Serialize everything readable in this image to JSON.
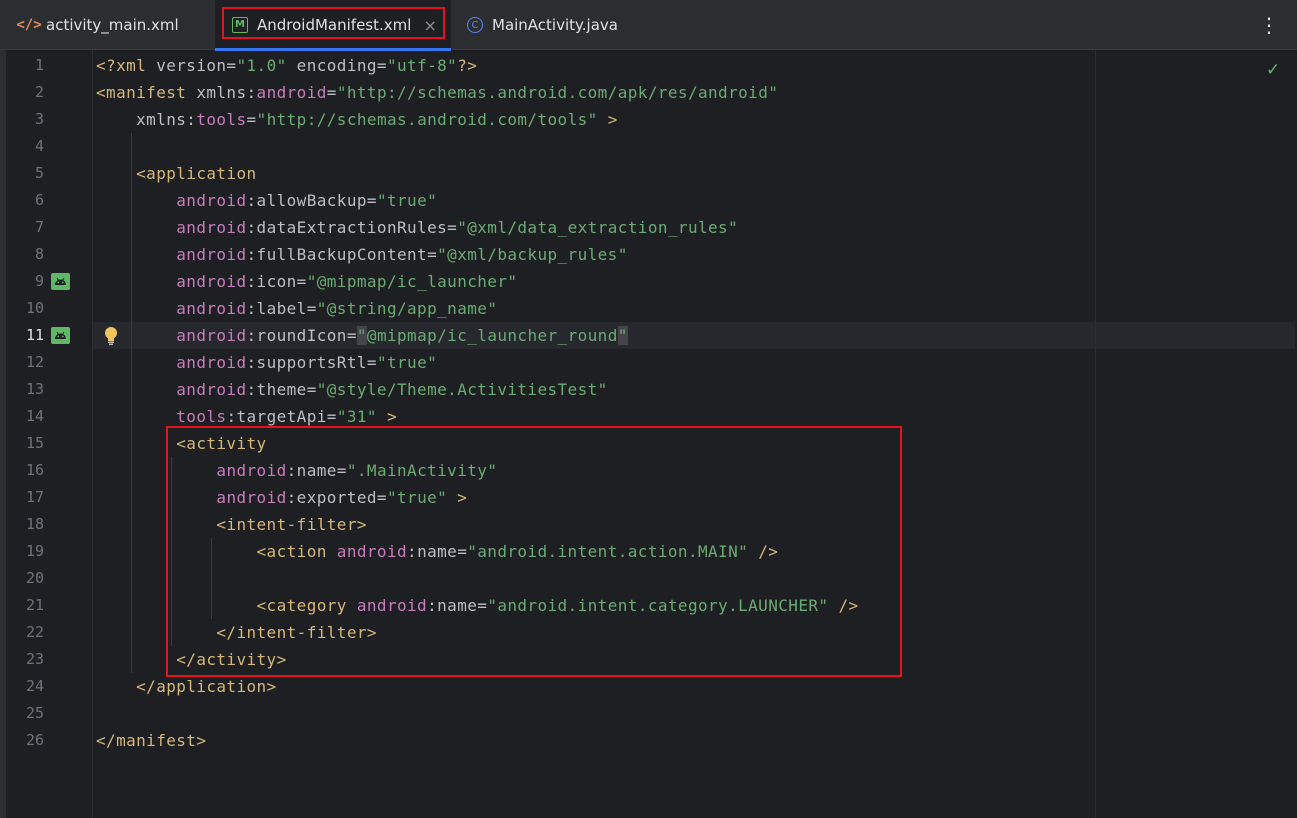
{
  "tabs": [
    {
      "label": "activity_main.xml",
      "icon": "xml-file-icon"
    },
    {
      "label": "AndroidManifest.xml",
      "icon": "manifest-file-icon",
      "active": true,
      "badge": "M"
    },
    {
      "label": "MainActivity.java",
      "icon": "java-class-icon",
      "badge": "C"
    }
  ],
  "tab_close": "×",
  "more_menu": "⋮",
  "inspection_status": "✓",
  "editor": {
    "current_line": 11,
    "lines": [
      {
        "n": "1"
      },
      {
        "n": "2"
      },
      {
        "n": "3"
      },
      {
        "n": "4"
      },
      {
        "n": "5"
      },
      {
        "n": "6"
      },
      {
        "n": "7"
      },
      {
        "n": "8"
      },
      {
        "n": "9"
      },
      {
        "n": "10"
      },
      {
        "n": "11"
      },
      {
        "n": "12"
      },
      {
        "n": "13"
      },
      {
        "n": "14"
      },
      {
        "n": "15"
      },
      {
        "n": "16"
      },
      {
        "n": "17"
      },
      {
        "n": "18"
      },
      {
        "n": "19"
      },
      {
        "n": "20"
      },
      {
        "n": "21"
      },
      {
        "n": "22"
      },
      {
        "n": "23"
      },
      {
        "n": "24"
      },
      {
        "n": "25"
      },
      {
        "n": "26"
      }
    ],
    "t": {
      "xml_decl_open": "<?xml",
      "version_attr": " version=",
      "version_val": "\"1.0\"",
      "encoding_attr": " encoding=",
      "encoding_val": "\"utf-8\"",
      "xml_decl_close": "?>",
      "manifest_open": "<manifest",
      "xmlns": " xmlns:",
      "android": "android",
      "tools": "tools",
      "eq": "=",
      "android_ns_url": "\"http://schemas.android.com/apk/res/android\"",
      "xmlns_indent": "    xmlns:",
      "tools_ns_url": "\"http://schemas.android.com/tools\"",
      "gt": " >",
      "application_open": "    <application",
      "indent8": "        ",
      "allowBackup": ":allowBackup=",
      "allowBackup_val": "\"true\"",
      "dataExtractionRules": ":dataExtractionRules=",
      "dataExtractionRules_val": "\"@xml/data_extraction_rules\"",
      "fullBackupContent": ":fullBackupContent=",
      "fullBackupContent_val": "\"@xml/backup_rules\"",
      "icon": ":icon=",
      "icon_val": "\"@mipmap/ic_launcher\"",
      "label": ":label=",
      "label_val": "\"@string/app_name\"",
      "roundIcon": ":roundIcon=",
      "quote": "\"",
      "roundIcon_val_mid": "@mipmap/ic_launcher_round",
      "supportsRtl": ":supportsRtl=",
      "supportsRtl_val": "\"true\"",
      "theme": ":theme=",
      "theme_val": "\"@style/Theme.ActivitiesTest\"",
      "targetApi": ":targetApi=",
      "targetApi_val": "\"31\"",
      "activity_open": "        <activity",
      "indent12": "            ",
      "name": ":name=",
      "name_val": "\".MainActivity\"",
      "exported": ":exported=",
      "exported_val": "\"true\"",
      "intent_filter_open": "            <intent-filter>",
      "action_open": "                <action ",
      "action_val": "\"android.intent.action.MAIN\"",
      "self_close": " />",
      "category_open": "                <category ",
      "category_val": "\"android.intent.category.LAUNCHER\"",
      "intent_filter_close": "            </intent-filter>",
      "activity_close": "        </activity>",
      "application_close": "    </application>",
      "manifest_close": "</manifest>"
    }
  }
}
